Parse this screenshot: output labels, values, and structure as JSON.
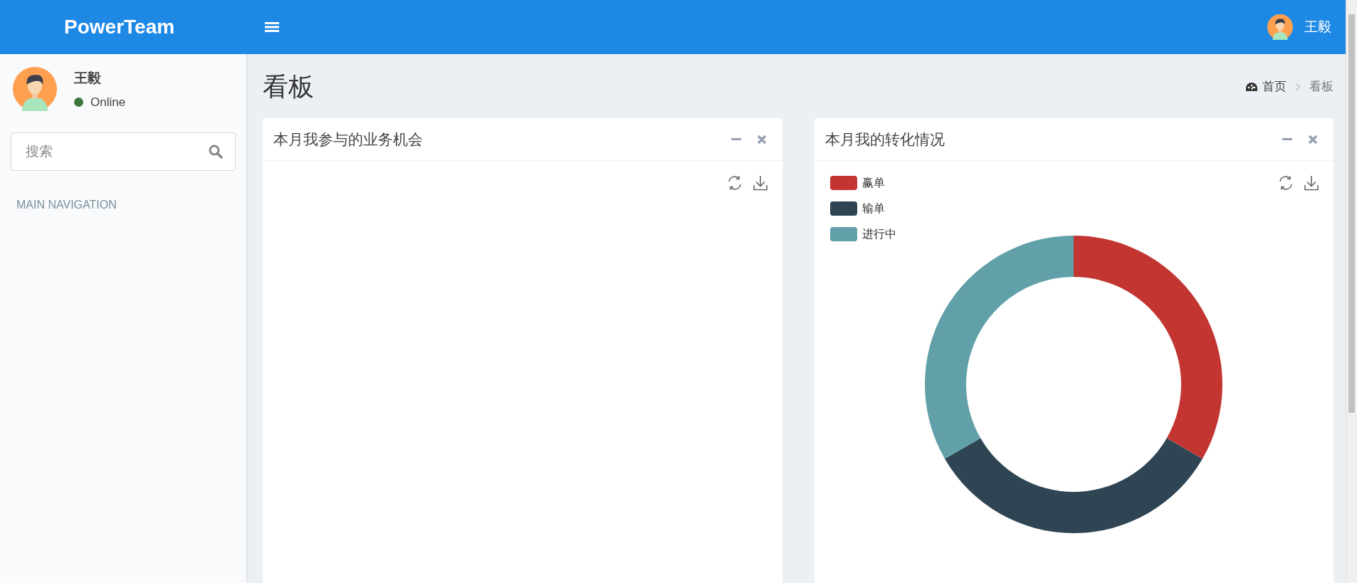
{
  "navbar": {
    "brand": "PowerTeam",
    "user_name": "王毅"
  },
  "sidebar": {
    "user": {
      "name": "王毅",
      "status": "Online"
    },
    "search": {
      "placeholder": "搜索"
    },
    "section_header": "MAIN NAVIGATION"
  },
  "content": {
    "title": "看板",
    "breadcrumb": [
      {
        "label": "首页",
        "kind": "home"
      },
      {
        "label": "看板",
        "kind": "current"
      }
    ]
  },
  "boxes": [
    {
      "title": "本月我参与的业务机会"
    },
    {
      "title": "本月我的转化情况",
      "legend": [
        {
          "label": "赢单",
          "color": "#c23531"
        },
        {
          "label": "输单",
          "color": "#2f4554"
        },
        {
          "label": "进行中",
          "color": "#61a0a8"
        }
      ]
    }
  ]
}
